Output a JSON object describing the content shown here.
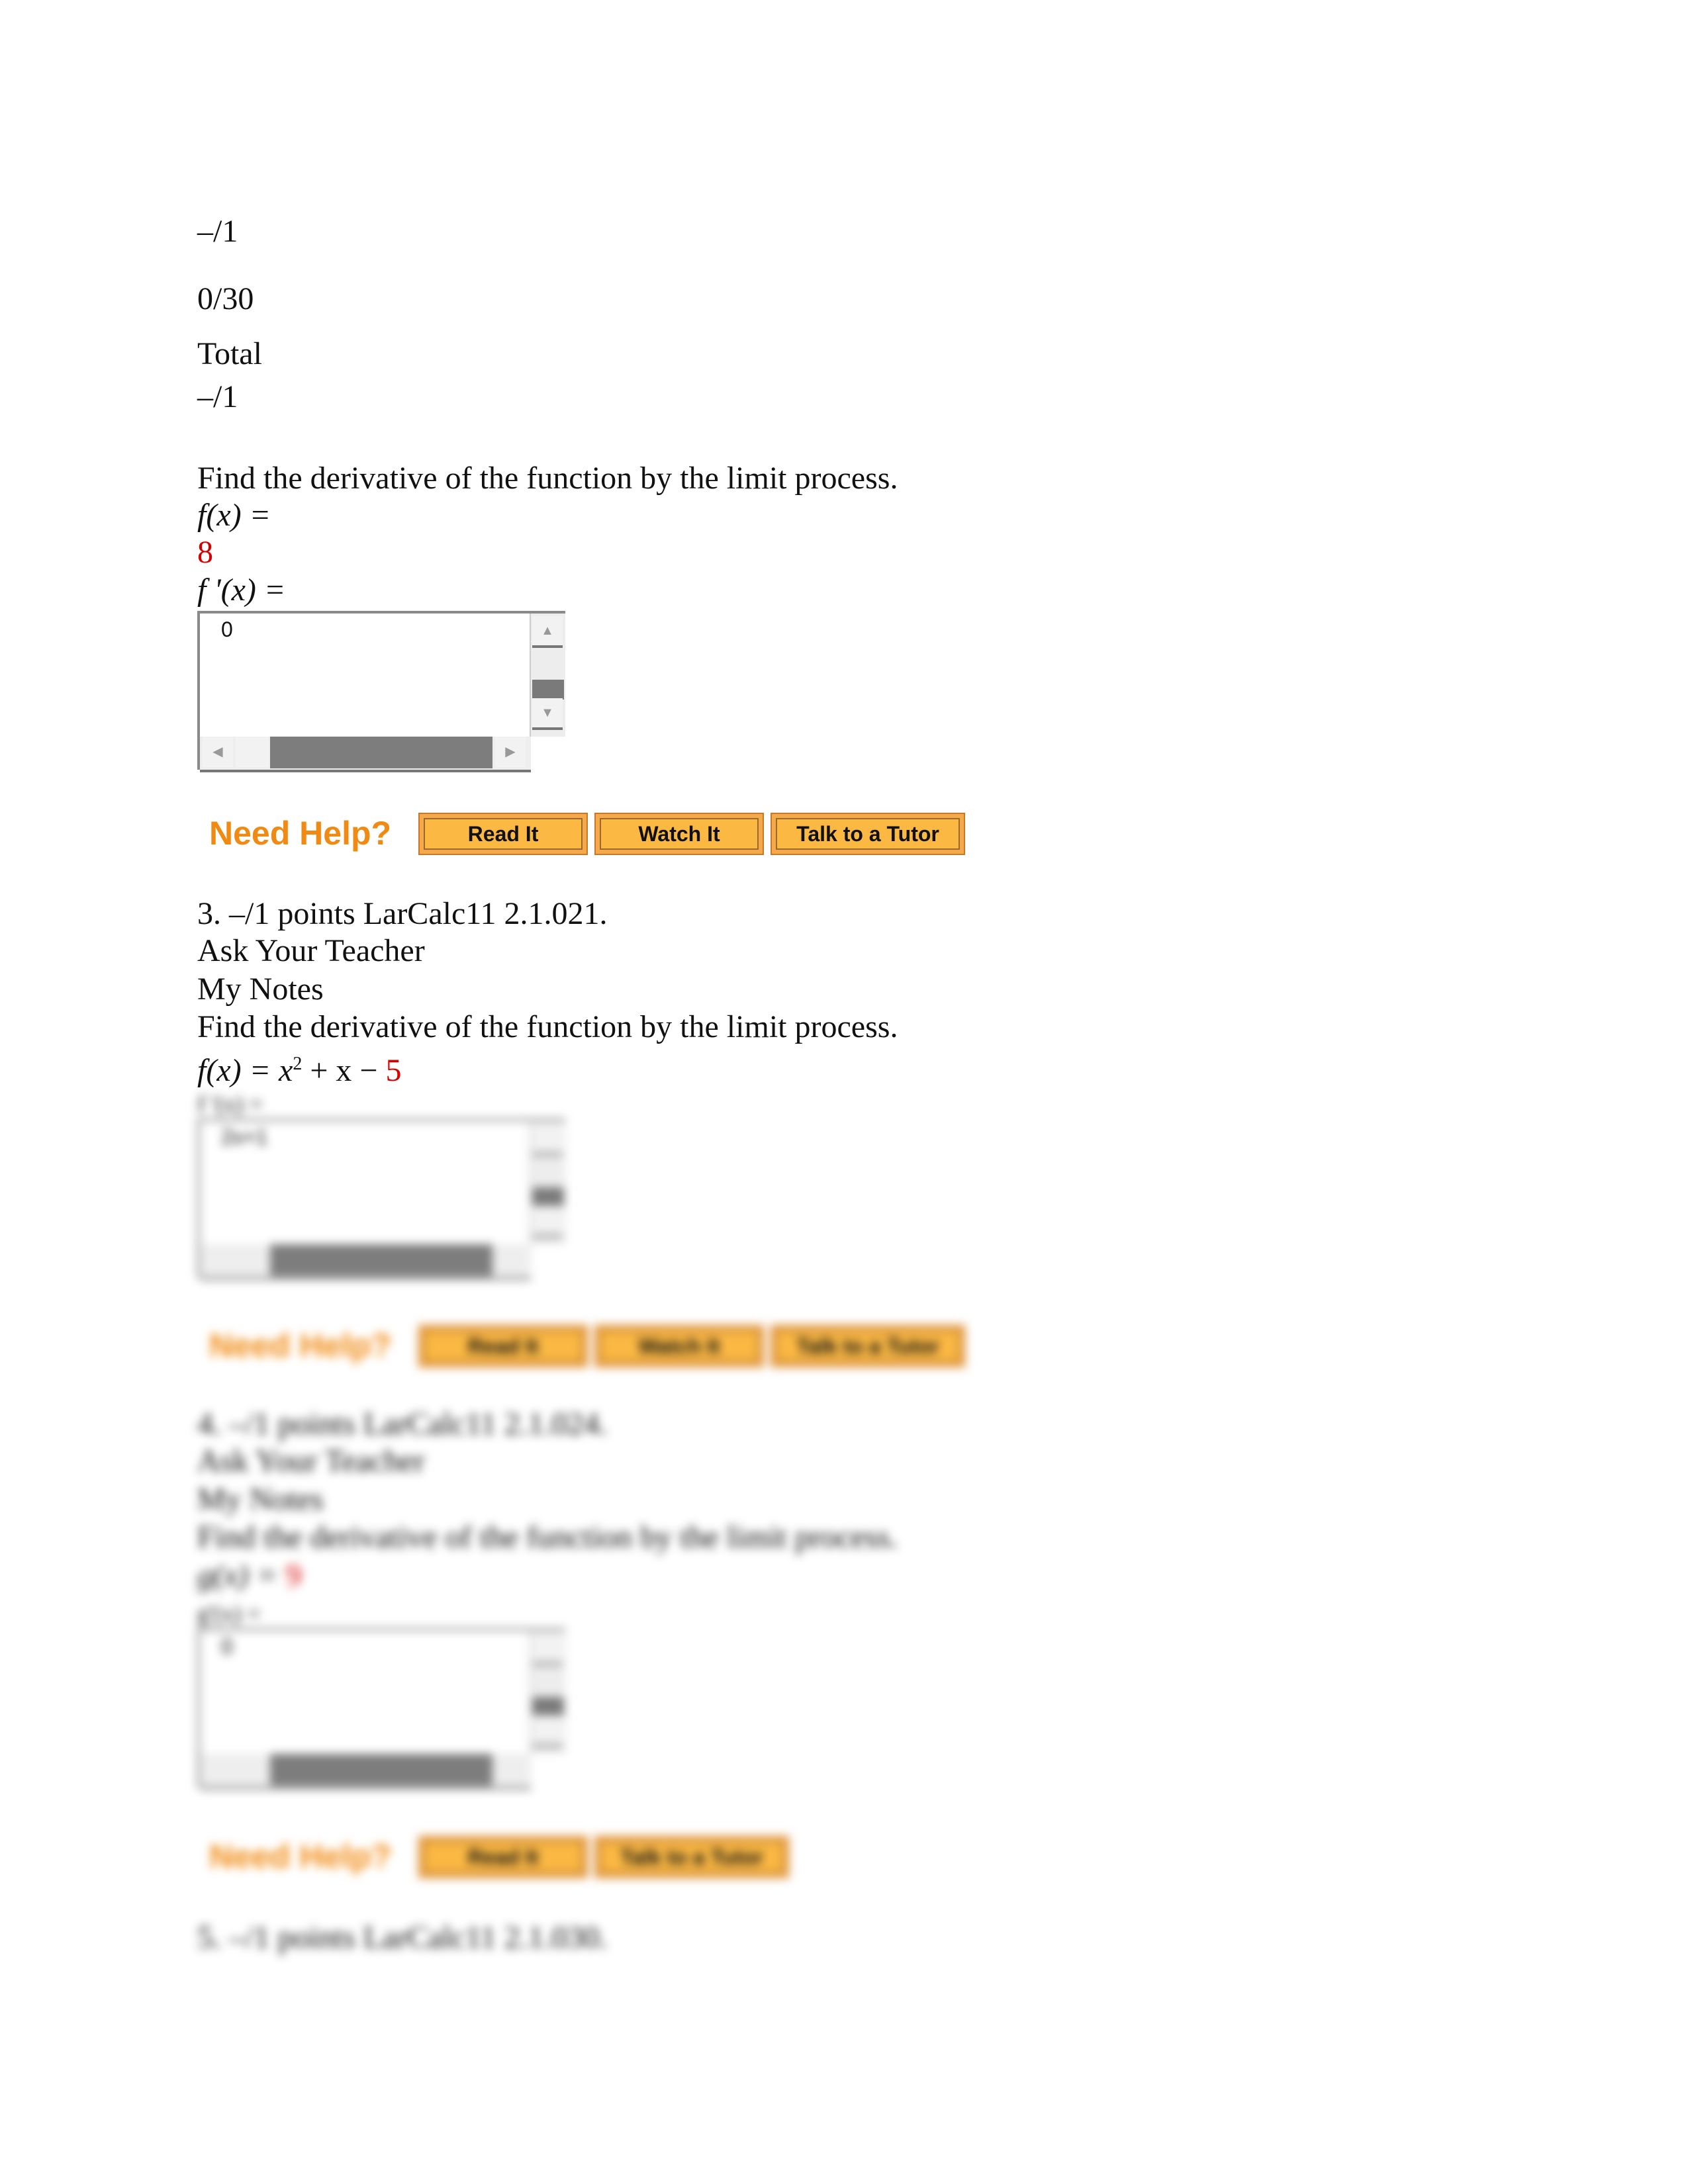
{
  "score_header": {
    "points_top": "–/1",
    "total_score": "0/30",
    "total_label": "Total",
    "points_bottom": "–/1"
  },
  "q2": {
    "prompt": "Find the derivative of the function by the limit process.",
    "function_label": "f(x) =",
    "function_value": "8",
    "derivative_label": "f '(x) =",
    "answer_value": "0"
  },
  "help": {
    "need_help": "Need Help?",
    "read_it": "Read It",
    "watch_it": "Watch It",
    "talk_tutor": "Talk to a Tutor"
  },
  "q3": {
    "header": "3. –/1 points LarCalc11 2.1.021.",
    "ask_teacher": "Ask Your Teacher",
    "my_notes": "My Notes",
    "prompt": "Find the derivative of the function by the limit process.",
    "function_prefix": "f(x) = x",
    "exponent": "2",
    "function_mid": " + x − ",
    "function_const": "5",
    "derivative_label": "f '(x) =",
    "answer_value": "2x+1"
  },
  "q4": {
    "header": "4. –/1 points LarCalc11 2.1.024.",
    "ask_teacher": "Ask Your Teacher",
    "my_notes": "My Notes",
    "prompt": "Find the derivative of the function by the limit process.",
    "function_prefix": "g(x) = ",
    "function_const": "9",
    "derivative_label": "g'(x) =",
    "answer_value": "0"
  },
  "q5": {
    "header": "5. –/1 points LarCalc11 2.1.030."
  },
  "colors": {
    "accent_red": "#d40000",
    "need_help_orange": "#f08a12",
    "button_orange": "#fbb843"
  }
}
